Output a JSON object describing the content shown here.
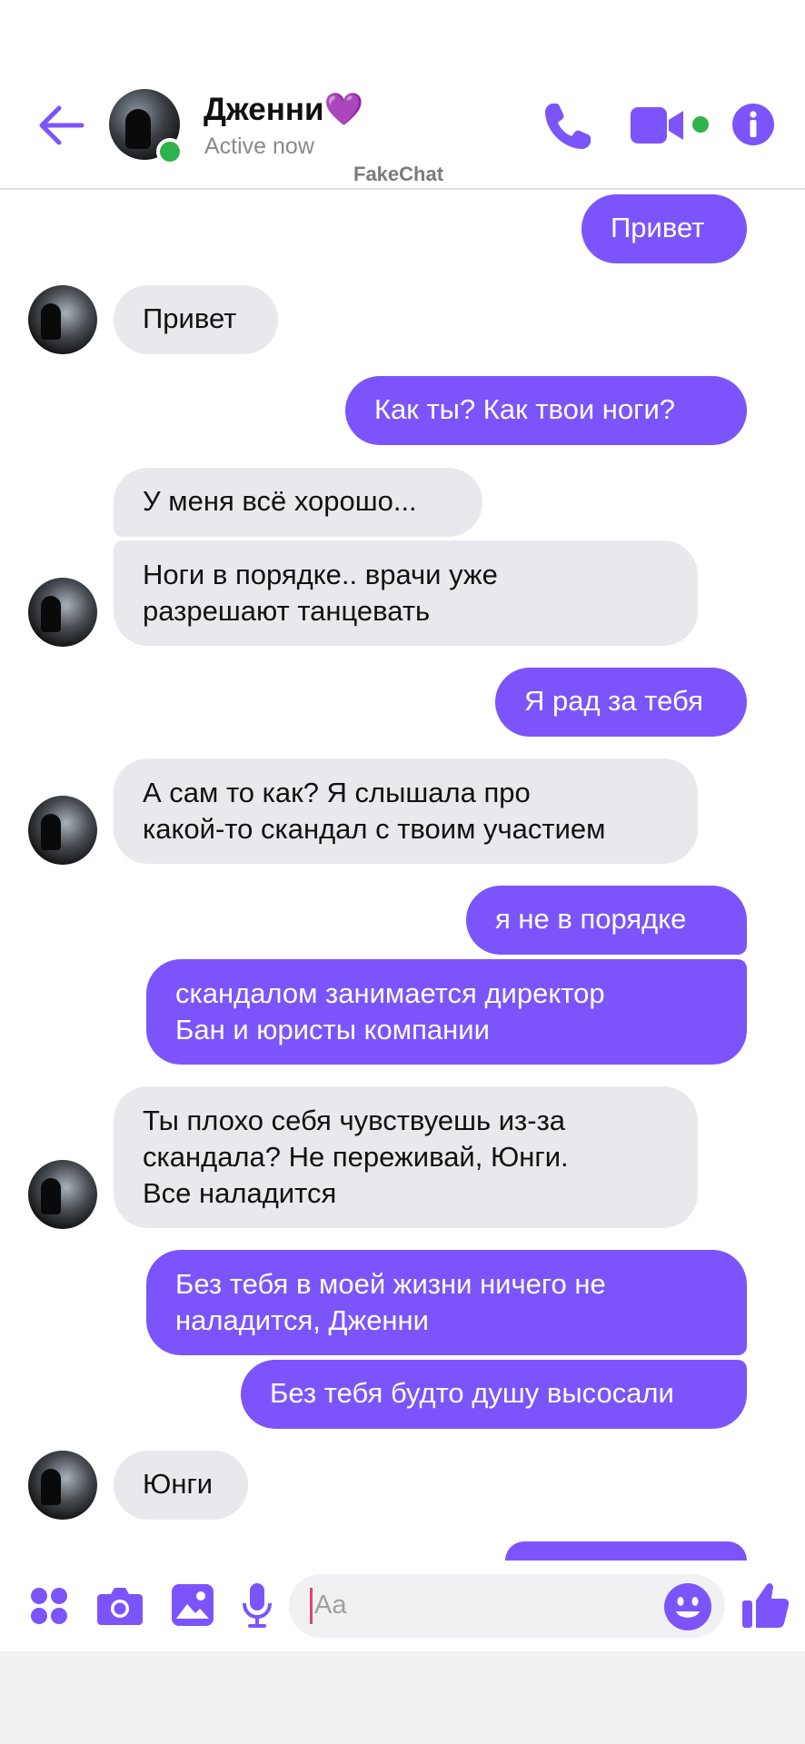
{
  "header": {
    "contact_name": "Дженни💜",
    "status": "Active now",
    "watermark": "FakeChat"
  },
  "messages": [
    {
      "from": "me",
      "text": "Привет"
    },
    {
      "from": "them",
      "text": "Привет"
    },
    {
      "from": "me",
      "text": "Как ты? Как твои ноги?"
    },
    {
      "from": "them",
      "text": "У меня всё хорошо..."
    },
    {
      "from": "them",
      "text": "Ноги в порядке.. врачи уже\nразрешают танцевать"
    },
    {
      "from": "me",
      "text": "Я рад за тебя"
    },
    {
      "from": "them",
      "text": "А сам то как? Я слышала про\nкакой-то скандал с твоим участием"
    },
    {
      "from": "me",
      "text": "я не в порядке"
    },
    {
      "from": "me",
      "text": "скандалом занимается директор\nБан и юристы компании"
    },
    {
      "from": "them",
      "text": "Ты плохо себя чувствуешь из-за\nскандала? Не переживай, Юнги.\nВсе наладится"
    },
    {
      "from": "me",
      "text": "Без тебя в моей жизни ничего не\nналадится, Дженни"
    },
    {
      "from": "me",
      "text": "Без тебя будто душу высосали"
    },
    {
      "from": "them",
      "text": "Юнги"
    }
  ],
  "composer": {
    "placeholder": "Aa"
  },
  "icons": {
    "back": "arrow-left-icon",
    "call": "phone-icon",
    "video": "video-camera-icon",
    "info": "info-icon",
    "apps": "four-dots-icon",
    "camera": "camera-icon",
    "gallery": "image-icon",
    "mic": "microphone-icon",
    "emoji": "smiley-icon",
    "like": "thumbs-up-icon"
  },
  "colors": {
    "accent": "#7b55fb",
    "incoming_bubble": "#e9e8ec",
    "online": "#2fb24a"
  }
}
